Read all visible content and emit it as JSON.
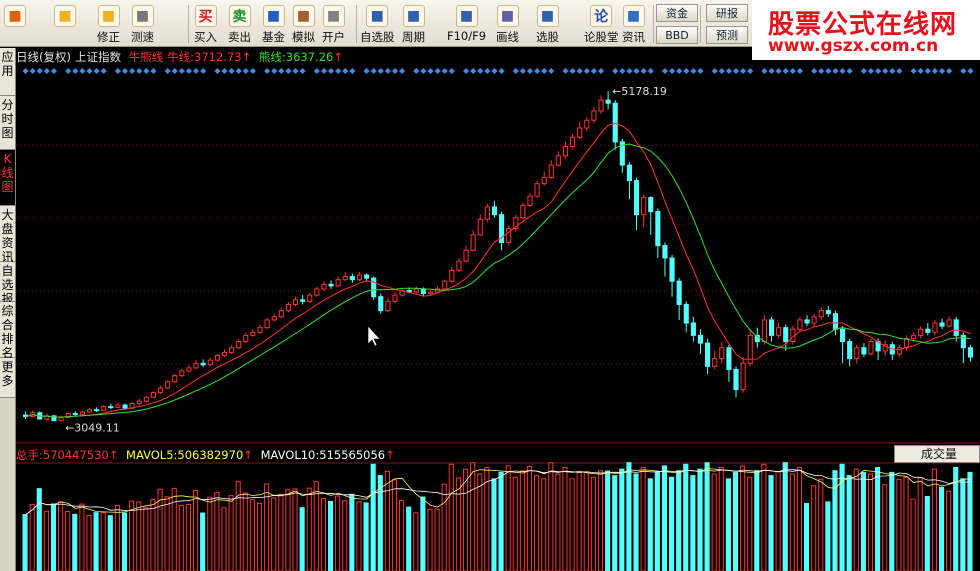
{
  "toolbar": {
    "items": [
      {
        "label": "",
        "icon": "add-icon"
      },
      {
        "label": "",
        "icon": "back-arrow-icon"
      },
      {
        "label": "修正",
        "icon": "adjust-icon"
      },
      {
        "label": "测速",
        "icon": "clock-icon"
      },
      {
        "label": "买入",
        "icon": "buy-icon",
        "glyph": "买"
      },
      {
        "label": "卖出",
        "icon": "sell-icon",
        "glyph": "卖"
      },
      {
        "label": "基金",
        "icon": "fund-icon"
      },
      {
        "label": "模拟",
        "icon": "hammer-icon"
      },
      {
        "label": "开户",
        "icon": "lock-icon"
      },
      {
        "label": "自选股",
        "icon": "star-folder-icon"
      },
      {
        "label": "周期",
        "icon": "period-icon"
      },
      {
        "label": "F10/F9",
        "icon": "f10-icon"
      },
      {
        "label": "画线",
        "icon": "pencil-icon"
      },
      {
        "label": "选股",
        "icon": "screen-icon"
      },
      {
        "label": "论股堂",
        "icon": "forum-icon",
        "glyph": "论"
      },
      {
        "label": "资讯",
        "icon": "news-icon"
      }
    ],
    "fund_btn": "资金",
    "bbd_btn": "BBD",
    "research_btn": "研报",
    "forecast_btn": "预测"
  },
  "watermark": {
    "main": "股票公式在线网",
    "url": "www.gszx.com.cn"
  },
  "sidebar": [
    "应用",
    "分时图",
    "K线图",
    "大盘资讯",
    "自选报",
    "综合排名",
    "更多"
  ],
  "header": {
    "period": "日线(复权)",
    "index_name": "上证指数",
    "bull_bear_label": "牛熊线",
    "bull_label": "牛线:",
    "bull_value": "3712.73",
    "bear_label": "熊线:",
    "bear_value": "3637.26",
    "arrow": "↑"
  },
  "colors": {
    "up": "#ff3030",
    "down": "#54ffff",
    "ma_red": "#ff3030",
    "ma_green": "#30e030",
    "diamond": "#3a8ef0"
  },
  "chart_data": {
    "type": "candlestick",
    "high_label": "5178.19",
    "low_label": "3049.11",
    "ylim": [
      2950,
      5250
    ],
    "candles": [
      [
        3085,
        3075,
        3110,
        3060
      ],
      [
        3075,
        3100,
        3115,
        3070
      ],
      [
        3100,
        3060,
        3110,
        3055
      ],
      [
        3060,
        3080,
        3095,
        3050
      ],
      [
        3080,
        3049,
        3085,
        3049
      ],
      [
        3049,
        3070,
        3080,
        3045
      ],
      [
        3070,
        3095,
        3100,
        3065
      ],
      [
        3095,
        3090,
        3110,
        3080
      ],
      [
        3090,
        3105,
        3115,
        3085
      ],
      [
        3105,
        3120,
        3130,
        3100
      ],
      [
        3120,
        3115,
        3135,
        3105
      ],
      [
        3115,
        3140,
        3150,
        3110
      ],
      [
        3140,
        3135,
        3160,
        3125
      ],
      [
        3135,
        3150,
        3165,
        3130
      ],
      [
        3150,
        3130,
        3160,
        3120
      ],
      [
        3130,
        3160,
        3170,
        3125
      ],
      [
        3160,
        3175,
        3190,
        3150
      ],
      [
        3175,
        3200,
        3210,
        3165
      ],
      [
        3200,
        3230,
        3240,
        3195
      ],
      [
        3230,
        3260,
        3275,
        3220
      ],
      [
        3260,
        3300,
        3310,
        3255
      ],
      [
        3300,
        3340,
        3350,
        3290
      ],
      [
        3340,
        3370,
        3385,
        3330
      ],
      [
        3370,
        3390,
        3410,
        3360
      ],
      [
        3390,
        3420,
        3440,
        3380
      ],
      [
        3420,
        3410,
        3445,
        3395
      ],
      [
        3410,
        3440,
        3455,
        3400
      ],
      [
        3440,
        3470,
        3480,
        3430
      ],
      [
        3470,
        3490,
        3510,
        3460
      ],
      [
        3490,
        3520,
        3535,
        3480
      ],
      [
        3520,
        3560,
        3575,
        3510
      ],
      [
        3560,
        3600,
        3615,
        3550
      ],
      [
        3600,
        3620,
        3640,
        3590
      ],
      [
        3620,
        3650,
        3670,
        3610
      ],
      [
        3650,
        3700,
        3715,
        3640
      ],
      [
        3700,
        3720,
        3740,
        3690
      ],
      [
        3720,
        3760,
        3780,
        3710
      ],
      [
        3760,
        3800,
        3815,
        3750
      ],
      [
        3800,
        3830,
        3850,
        3790
      ],
      [
        3830,
        3820,
        3860,
        3800
      ],
      [
        3820,
        3860,
        3875,
        3810
      ],
      [
        3860,
        3900,
        3915,
        3850
      ],
      [
        3900,
        3930,
        3950,
        3890
      ],
      [
        3930,
        3920,
        3955,
        3900
      ],
      [
        3920,
        3960,
        3980,
        3910
      ],
      [
        3960,
        3980,
        4010,
        3950
      ],
      [
        3980,
        3960,
        4000,
        3940
      ],
      [
        3960,
        3990,
        4010,
        3950
      ],
      [
        3990,
        3970,
        4000,
        3950
      ],
      [
        3970,
        3850,
        3980,
        3830
      ],
      [
        3850,
        3760,
        3870,
        3740
      ],
      [
        3760,
        3820,
        3840,
        3750
      ],
      [
        3820,
        3860,
        3880,
        3810
      ],
      [
        3860,
        3890,
        3905,
        3850
      ],
      [
        3890,
        3880,
        3910,
        3870
      ],
      [
        3880,
        3900,
        3915,
        3870
      ],
      [
        3900,
        3870,
        3910,
        3850
      ],
      [
        3870,
        3880,
        3890,
        3860
      ],
      [
        3880,
        3900,
        3920,
        3870
      ],
      [
        3900,
        3950,
        3960,
        3890
      ],
      [
        3950,
        4020,
        4040,
        3940
      ],
      [
        4020,
        4080,
        4100,
        4010
      ],
      [
        4080,
        4150,
        4180,
        4070
      ],
      [
        4150,
        4250,
        4280,
        4140
      ],
      [
        4250,
        4350,
        4380,
        4240
      ],
      [
        4350,
        4430,
        4450,
        4330
      ],
      [
        4430,
        4380,
        4470,
        4360
      ],
      [
        4380,
        4200,
        4400,
        4150
      ],
      [
        4200,
        4290,
        4310,
        4180
      ],
      [
        4290,
        4360,
        4380,
        4270
      ],
      [
        4360,
        4440,
        4460,
        4350
      ],
      [
        4440,
        4500,
        4520,
        4430
      ],
      [
        4500,
        4580,
        4600,
        4490
      ],
      [
        4580,
        4620,
        4660,
        4570
      ],
      [
        4620,
        4700,
        4730,
        4610
      ],
      [
        4700,
        4760,
        4790,
        4690
      ],
      [
        4760,
        4820,
        4850,
        4740
      ],
      [
        4820,
        4880,
        4900,
        4800
      ],
      [
        4880,
        4940,
        4980,
        4870
      ],
      [
        4940,
        4990,
        5010,
        4920
      ],
      [
        4990,
        5050,
        5080,
        4970
      ],
      [
        5050,
        5120,
        5150,
        5030
      ],
      [
        5120,
        5100,
        5178,
        5060
      ],
      [
        5100,
        4850,
        5120,
        4800
      ],
      [
        4850,
        4700,
        4870,
        4650
      ],
      [
        4700,
        4600,
        4720,
        4480
      ],
      [
        4600,
        4380,
        4620,
        4280
      ],
      [
        4380,
        4490,
        4510,
        4300
      ],
      [
        4490,
        4400,
        4500,
        4250
      ],
      [
        4400,
        4180,
        4420,
        4100
      ],
      [
        4180,
        4100,
        4200,
        3980
      ],
      [
        4100,
        3950,
        4120,
        3850
      ],
      [
        3950,
        3800,
        3970,
        3700
      ],
      [
        3800,
        3680,
        3820,
        3620
      ],
      [
        3680,
        3600,
        3720,
        3560
      ],
      [
        3600,
        3550,
        3640,
        3480
      ],
      [
        3550,
        3400,
        3580,
        3350
      ],
      [
        3400,
        3450,
        3500,
        3380
      ],
      [
        3450,
        3520,
        3560,
        3420
      ],
      [
        3520,
        3380,
        3540,
        3300
      ],
      [
        3380,
        3250,
        3400,
        3200
      ],
      [
        3250,
        3420,
        3460,
        3230
      ],
      [
        3420,
        3600,
        3640,
        3400
      ],
      [
        3600,
        3560,
        3650,
        3520
      ],
      [
        3560,
        3700,
        3730,
        3540
      ],
      [
        3700,
        3600,
        3720,
        3560
      ],
      [
        3600,
        3650,
        3680,
        3580
      ],
      [
        3650,
        3560,
        3670,
        3500
      ],
      [
        3560,
        3640,
        3660,
        3540
      ],
      [
        3640,
        3700,
        3720,
        3620
      ],
      [
        3700,
        3680,
        3730,
        3660
      ],
      [
        3680,
        3720,
        3740,
        3660
      ],
      [
        3720,
        3760,
        3780,
        3700
      ],
      [
        3760,
        3740,
        3790,
        3720
      ],
      [
        3740,
        3640,
        3760,
        3600
      ],
      [
        3640,
        3560,
        3660,
        3420
      ],
      [
        3560,
        3450,
        3580,
        3400
      ],
      [
        3450,
        3520,
        3540,
        3420
      ],
      [
        3520,
        3480,
        3550,
        3460
      ],
      [
        3480,
        3560,
        3580,
        3470
      ],
      [
        3560,
        3500,
        3580,
        3440
      ],
      [
        3500,
        3540,
        3570,
        3470
      ],
      [
        3540,
        3480,
        3560,
        3440
      ],
      [
        3480,
        3520,
        3540,
        3460
      ],
      [
        3520,
        3580,
        3600,
        3500
      ],
      [
        3580,
        3600,
        3620,
        3560
      ],
      [
        3600,
        3640,
        3660,
        3580
      ],
      [
        3640,
        3620,
        3680,
        3600
      ],
      [
        3620,
        3680,
        3700,
        3600
      ],
      [
        3680,
        3660,
        3710,
        3640
      ],
      [
        3660,
        3700,
        3720,
        3650
      ],
      [
        3700,
        3600,
        3720,
        3560
      ],
      [
        3600,
        3520,
        3620,
        3420
      ],
      [
        3520,
        3460,
        3540,
        3430
      ]
    ]
  },
  "volume": {
    "total_label": "总手:",
    "total_value": "570447530",
    "mavol5_label": "MAVOL5:",
    "mavol5_value": "506382970",
    "mavol10_label": "MAVOL10:",
    "mavol10_value": "515565056",
    "arrow": "↑",
    "select_label": "成交量"
  }
}
